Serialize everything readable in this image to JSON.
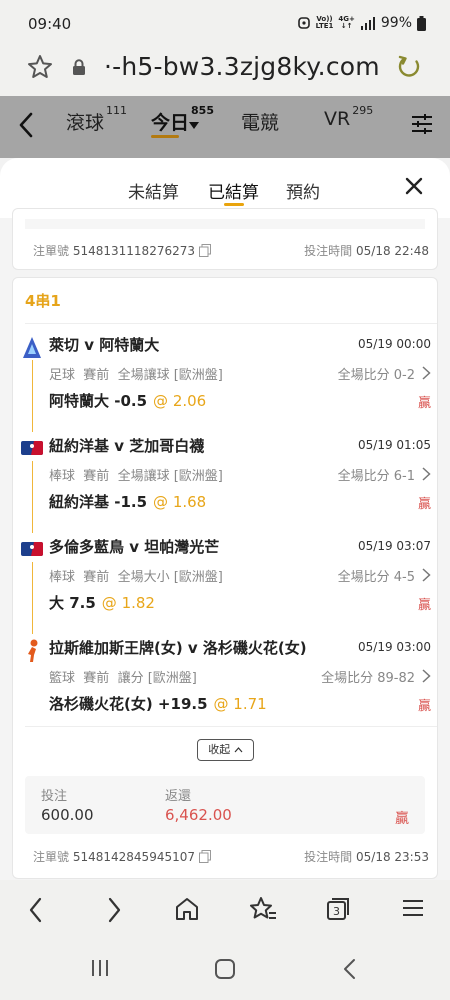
{
  "status_bar": {
    "time": "09:40",
    "volte": "Vo))",
    "lte": "LTE1",
    "net": "4G+",
    "battery": "99%"
  },
  "browser": {
    "url": "·-h5-bw3.3zjg8ky.com"
  },
  "app_nav": {
    "tabs": [
      {
        "label": "滾球",
        "count": "111"
      },
      {
        "label": "今日",
        "count": "855"
      },
      {
        "label": "電競",
        "count": ""
      },
      {
        "label": "VR",
        "count": "295"
      }
    ]
  },
  "sheet": {
    "tabs": [
      "未結算",
      "已結算",
      "預約"
    ],
    "active_tab": "已結算"
  },
  "prev_bet": {
    "ticket_label": "注單號",
    "ticket_no": "5148131118276273",
    "time_label": "投注時間",
    "time": "05/18 22:48"
  },
  "bet": {
    "type": "4串1",
    "legs": [
      {
        "sport_icon": "premier-league-lion-icon",
        "match": "萊切 v 阿特蘭大",
        "time": "05/19 00:00",
        "sport": "足球",
        "phase": "賽前",
        "market": "全場讓球",
        "odds_type": "[歐洲盤]",
        "score": "全場比分 0-2",
        "pick": "阿特蘭大 -0.5",
        "odds": "2.06",
        "result": "贏"
      },
      {
        "sport_icon": "mlb-logo-icon",
        "match": "紐約洋基 v 芝加哥白襪",
        "time": "05/19 01:05",
        "sport": "棒球",
        "phase": "賽前",
        "market": "全場讓球",
        "odds_type": "[歐洲盤]",
        "score": "全場比分 6-1",
        "pick": "紐約洋基 -1.5",
        "odds": "1.68",
        "result": "贏"
      },
      {
        "sport_icon": "mlb-logo-icon",
        "match": "多倫多藍鳥 v 坦帕灣光芒",
        "time": "05/19 03:07",
        "sport": "棒球",
        "phase": "賽前",
        "market": "全場大小",
        "odds_type": "[歐洲盤]",
        "score": "全場比分 4-5",
        "pick": "大 7.5",
        "odds": "1.82",
        "result": "贏"
      },
      {
        "sport_icon": "wnba-logo-icon",
        "match": "拉斯維加斯王牌(女) v 洛杉磯火花(女)",
        "time": "05/19 03:00",
        "sport": "籃球",
        "phase": "賽前",
        "market": "讓分",
        "odds_type": "[歐洲盤]",
        "score": "全場比分 89-82",
        "pick": "洛杉磯火花(女) +19.5",
        "odds": "1.71",
        "result": "贏"
      }
    ],
    "collapse_label": "收起",
    "stake_label": "投注",
    "stake": "600.00",
    "return_label": "返還",
    "return": "6,462.00",
    "status": "贏",
    "ticket_label": "注單號",
    "ticket_no": "5148142845945107",
    "time_label": "投注時間",
    "time": "05/18 23:53"
  },
  "colors": {
    "accent": "#e8a61a",
    "win": "#d9534f",
    "header_gray": "#a5a5a5"
  }
}
